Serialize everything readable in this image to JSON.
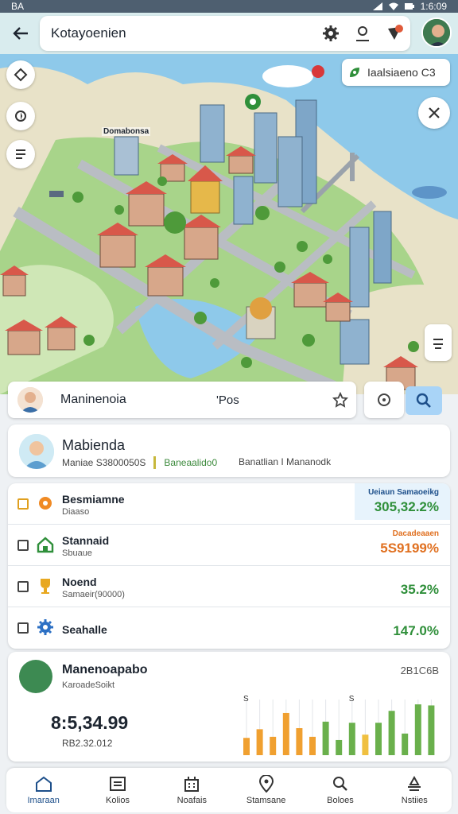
{
  "status_bar": {
    "left": "BA ",
    "right": "1:6:09"
  },
  "header": {
    "search_value": "Kotayoenien"
  },
  "map": {
    "label": "Domabonsa ",
    "info_chip": "Iaalsiaeno   C3"
  },
  "location_search": {
    "name": "Maninenoia",
    "pos_label": "'Pos"
  },
  "profile": {
    "name": "Mabienda",
    "meta1": "Maniae  S3800050S",
    "meta2": "Baneaalido0",
    "meta3": "Banatlian  I  Mananodk"
  },
  "list": [
    {
      "title": "Besmiamne",
      "sub": "Diaaso",
      "value": "305,32.2%",
      "value_label": "Ueiaun   Samaoeikg",
      "value_color": "#2f8f3a",
      "highlight": true,
      "icon": "badge-icon"
    },
    {
      "title": "Stannaid",
      "sub": "Sbuaue",
      "value": "5S9199%",
      "value_label": "Dacadeaaen",
      "value_color": "#e07020",
      "highlight": false,
      "icon": "house-icon"
    },
    {
      "title": "Noend",
      "sub": "Samaeir(90000)",
      "value": "35.2%",
      "value_label": "",
      "value_color": "#2f8f3a",
      "highlight": false,
      "icon": "trophy-icon"
    },
    {
      "title": "Seahalle",
      "sub": "",
      "value": "147.0%",
      "value_label": "",
      "value_color": "#2f8f3a",
      "highlight": false,
      "icon": "gear-icon"
    }
  ],
  "stats": {
    "title": "Manenoapabo",
    "sub": "KaroadeSoikt",
    "right": "2B1C6B",
    "big_value": "8:5,34.99",
    "small_value": "RB2.32.012",
    "chart_data": {
      "type": "bar",
      "annotations": [
        "S",
        "S"
      ],
      "values": [
        32,
        48,
        34,
        78,
        50,
        34,
        62,
        28,
        60,
        38,
        60,
        82,
        40,
        94,
        92
      ]
    }
  },
  "nav": [
    {
      "label": "Imaraan",
      "icon": "home-icon"
    },
    {
      "label": "Kolios",
      "icon": "list-icon"
    },
    {
      "label": "Noafais",
      "icon": "building-icon"
    },
    {
      "label": "Stamsane",
      "icon": "pin-icon"
    },
    {
      "label": "Boloes",
      "icon": "search-icon"
    },
    {
      "label": "Nstiies",
      "icon": "tray-icon"
    }
  ],
  "colors": {
    "accent": "#a9d4f7",
    "green": "#2f8f3a",
    "orange": "#e07020",
    "water": "#8ec9ea"
  }
}
